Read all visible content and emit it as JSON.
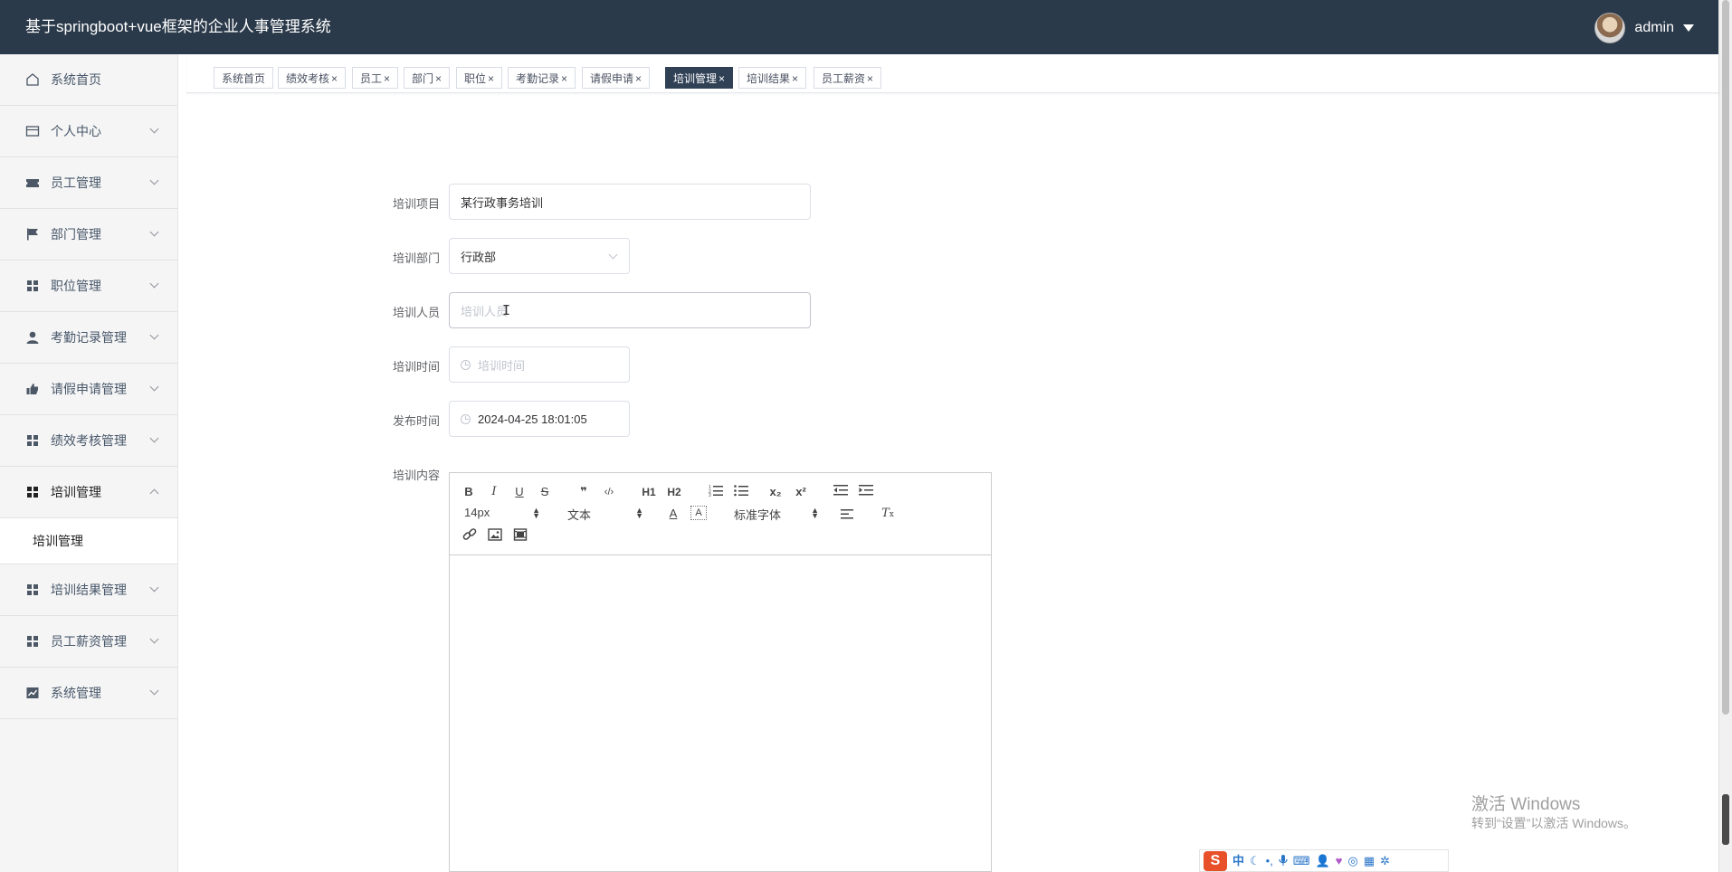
{
  "header": {
    "title": "基于springboot+vue框架的企业人事管理系统",
    "user": "admin"
  },
  "sidebar": {
    "items": [
      {
        "label": "系统首页",
        "icon": "home-icon"
      },
      {
        "label": "个人中心",
        "icon": "id-card-icon"
      },
      {
        "label": "员工管理",
        "icon": "ticket-icon"
      },
      {
        "label": "部门管理",
        "icon": "flag-icon"
      },
      {
        "label": "职位管理",
        "icon": "grid-icon"
      },
      {
        "label": "考勤记录管理",
        "icon": "user-icon"
      },
      {
        "label": "请假申请管理",
        "icon": "thumb-icon"
      },
      {
        "label": "绩效考核管理",
        "icon": "grid-icon"
      },
      {
        "label": "培训管理",
        "icon": "grid-icon"
      },
      {
        "label": "培训结果管理",
        "icon": "grid-icon"
      },
      {
        "label": "员工薪资管理",
        "icon": "grid-icon"
      },
      {
        "label": "系统管理",
        "icon": "chart-icon"
      }
    ],
    "submenu_label": "培训管理"
  },
  "tags": [
    "系统首页",
    "绩效考核",
    "员工",
    "部门",
    "职位",
    "考勤记录",
    "请假申请",
    "培训管理",
    "培训结果",
    "员工薪资"
  ],
  "tags_close": "×",
  "form": {
    "project_label": "培训项目",
    "project_value": "某行政事务培训",
    "dept_label": "培训部门",
    "dept_value": "行政部",
    "people_label": "培训人员",
    "people_placeholder": "培训人员",
    "time_label": "培训时间",
    "time_placeholder": "培训时间",
    "publish_label": "发布时间",
    "publish_value": "2024-04-25 18:01:05",
    "content_label": "培训内容"
  },
  "editor": {
    "font_size": "14px",
    "block_type": "文本",
    "font_family": "标准字体",
    "h1": "H1",
    "h2": "H2",
    "bold": "B",
    "italic": "I",
    "underline": "U",
    "strike": "S",
    "quote": "❞",
    "code": "‹/›",
    "sub": "x₂",
    "sup": "x²",
    "color": "A",
    "bg": "A",
    "clean": "T"
  },
  "watermark": {
    "line1": "激活 Windows",
    "line2": "转到“设置”以激活 Windows。"
  },
  "ime": {
    "logo": "S",
    "mode": "中"
  }
}
